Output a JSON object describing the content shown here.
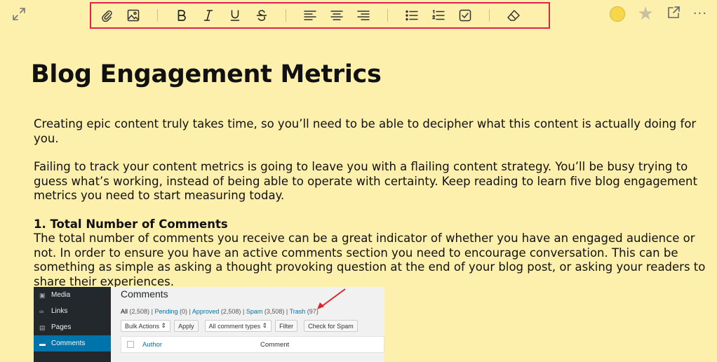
{
  "toolbar": {
    "items": [
      "attach-icon",
      "image-icon",
      "bold-icon",
      "italic-icon",
      "underline-icon",
      "strikethrough-icon",
      "align-left-icon",
      "align-center-icon",
      "align-right-icon",
      "bulleted-list-icon",
      "numbered-list-icon",
      "checkbox-icon",
      "eraser-icon"
    ],
    "highlight_color": "#e0234e"
  },
  "note_color": "#f7d64a",
  "more_label": "···",
  "note": {
    "title": "Blog Engagement Metrics",
    "paragraphs": [
      "Creating epic content truly takes time, so you’ll need to be able to decipher what this content is actually doing for you.",
      "Failing to track your content metrics is going to leave you with a flailing content strategy. You’ll be busy trying to guess what’s working, instead of being able to operate with certainty. Keep reading to learn five blog engagement metrics you need to start measuring today."
    ],
    "section_heading": "1. Total Number of Comments",
    "section_body": "The total number of comments you receive can be a great indicator of whether you have an engaged audience or not. In order to ensure you have an active comments section you need to encourage conversation. This can be something as simple as asking a thought provoking question at the end of your blog post, or asking your readers to share their experiences."
  },
  "embedded_screenshot": {
    "sidebar": [
      "Media",
      "Links",
      "Pages",
      "Comments"
    ],
    "heading": "Comments",
    "filters": {
      "all": "All",
      "all_count": "(2,508)",
      "pending": "Pending",
      "pending_count": "(0)",
      "approved": "Approved",
      "approved_count": "(2,508)",
      "spam": "Spam",
      "spam_count": "(3,508)",
      "trash": "Trash",
      "trash_count": "(97)",
      "separator": "|"
    },
    "bulk_actions": "Bulk Actions",
    "apply": "Apply",
    "comment_types": "All comment types",
    "filter": "Filter",
    "check_spam": "Check for Spam",
    "col_author": "Author",
    "col_comment": "Comment",
    "arrow_color": "#e0232a"
  }
}
